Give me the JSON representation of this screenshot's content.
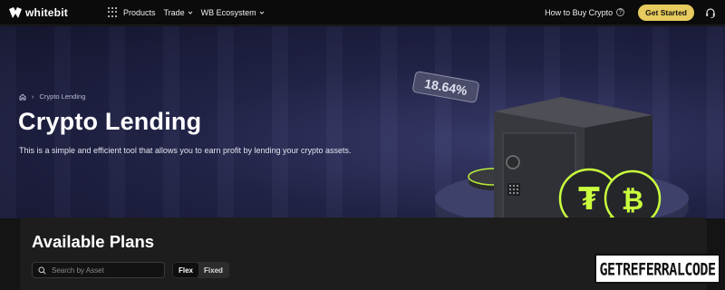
{
  "brand": {
    "name": "whitebit"
  },
  "nav": {
    "items": [
      {
        "label": "Products"
      },
      {
        "label": "Trade"
      },
      {
        "label": "WB Ecosystem"
      }
    ],
    "how_to_buy": "How to Buy Crypto",
    "get_started": "Get Started"
  },
  "hero": {
    "breadcrumb": "Crypto Lending",
    "title": "Crypto Lending",
    "subtitle": "This is a simple and efficient tool that allows you to earn profit by lending your crypto assets.",
    "rate": "18.64%"
  },
  "plans": {
    "title": "Available Plans",
    "search_placeholder": "Search by Asset",
    "toggle": [
      {
        "label": "Flex",
        "active": true
      },
      {
        "label": "Fixed",
        "active": false
      }
    ]
  },
  "watermark": {
    "text": "GetReferralCode"
  },
  "colors": {
    "accent": "#e8cb5e",
    "neon": "#c9ff3d",
    "hero_bg": "#23254a"
  }
}
